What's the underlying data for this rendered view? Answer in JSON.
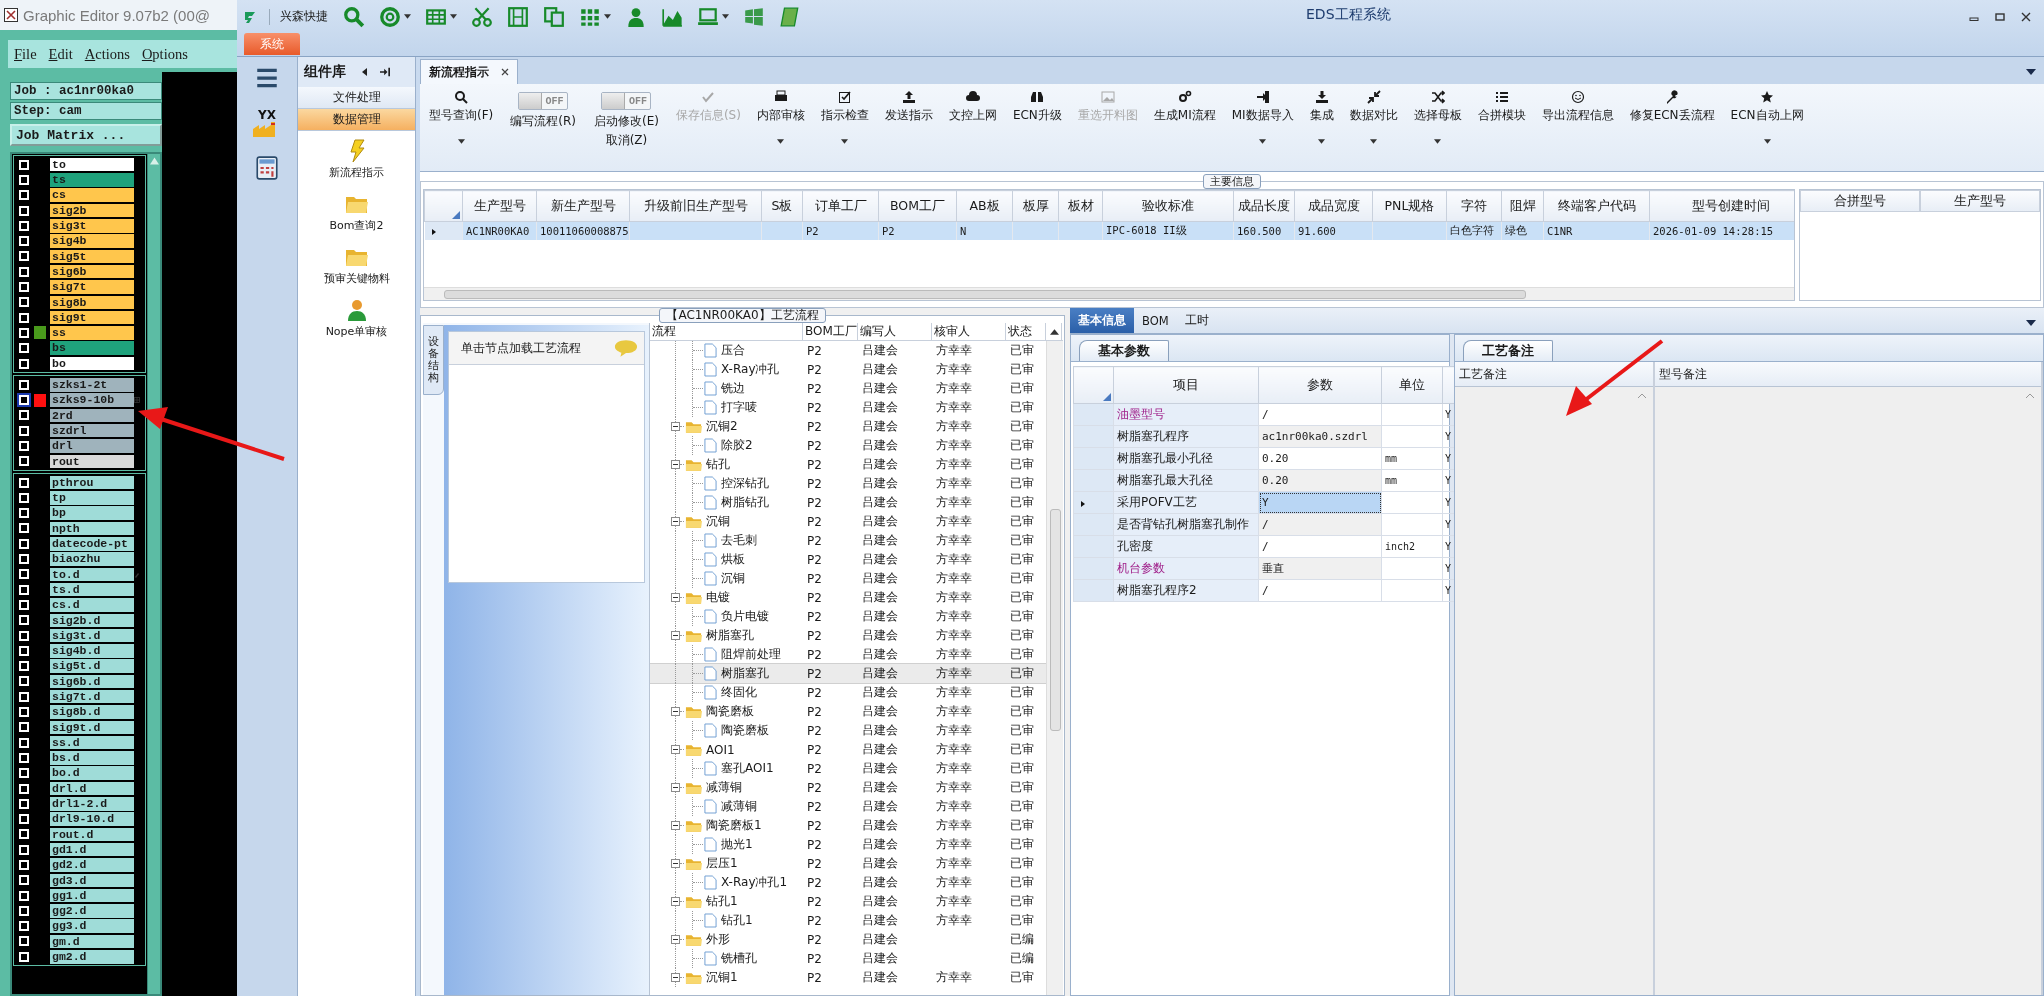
{
  "graphic_editor": {
    "title": "Graphic Editor 9.07b2 (00@",
    "menu": [
      "File",
      "Edit",
      "Actions",
      "Options"
    ],
    "job": "Job : ac1nr00ka0",
    "step": "Step: cam",
    "matrix_button": "Job Matrix ...",
    "layer_groups": [
      [
        {
          "name": "to",
          "color": "#ffffff",
          "checked": false,
          "selected": false
        },
        {
          "name": "ts",
          "color": "#1fa27c",
          "checked": false,
          "selected": false
        },
        {
          "name": "cs",
          "color": "#ffc64c",
          "checked": false,
          "selected": false
        },
        {
          "name": "sig2b",
          "color": "#ffc64c",
          "checked": false,
          "selected": false
        },
        {
          "name": "sig3t",
          "color": "#ffc64c",
          "checked": false,
          "selected": false
        },
        {
          "name": "sig4b",
          "color": "#ffc64c",
          "checked": false,
          "selected": false
        },
        {
          "name": "sig5t",
          "color": "#ffc64c",
          "checked": false,
          "selected": false
        },
        {
          "name": "sig6b",
          "color": "#ffc64c",
          "checked": false,
          "selected": false
        },
        {
          "name": "sig7t",
          "color": "#ffc64c",
          "checked": false,
          "selected": false
        },
        {
          "name": "sig8b",
          "color": "#ffc64c",
          "checked": false,
          "selected": false
        },
        {
          "name": "sig9t",
          "color": "#ffc64c",
          "checked": false,
          "selected": false
        },
        {
          "name": "ss",
          "color": "#ffc64c",
          "checked": false,
          "selected": false,
          "marker": {
            "color": "#4a9a1c"
          }
        },
        {
          "name": "bs",
          "color": "#1fa27c",
          "checked": false,
          "selected": false
        },
        {
          "name": "bo",
          "color": "#ffffff",
          "checked": false,
          "selected": false
        }
      ],
      [
        {
          "name": "szks1-2t",
          "color": "#9fb3bc",
          "checked": false,
          "selected": false
        },
        {
          "name": "szks9-10b",
          "color": "#9fb3bc",
          "checked": false,
          "selected": true,
          "marker": {
            "color": "#ff1010"
          },
          "badge": {
            "kind": "grid"
          }
        },
        {
          "name": "2rd",
          "color": "#9fb3bc",
          "checked": false,
          "selected": false
        },
        {
          "name": "szdrl",
          "color": "#9fb3bc",
          "checked": false,
          "selected": false
        },
        {
          "name": "drl",
          "color": "#9fb3bc",
          "checked": false,
          "selected": false
        },
        {
          "name": "rout",
          "color": "#d9d9d9",
          "checked": false,
          "selected": false
        }
      ],
      [
        {
          "name": "pthrou",
          "color": "#9fdcd8",
          "checked": false,
          "selected": false
        },
        {
          "name": "tp",
          "color": "#9fdcd8",
          "checked": false,
          "selected": false
        },
        {
          "name": "bp",
          "color": "#9fdcd8",
          "checked": false,
          "selected": false
        },
        {
          "name": "npth",
          "color": "#9fdcd8",
          "checked": false,
          "selected": false
        },
        {
          "name": "datecode-pt",
          "color": "#9fdcd8",
          "checked": false,
          "selected": false
        },
        {
          "name": "biaozhu",
          "color": "#9fdcd8",
          "checked": false,
          "selected": false
        },
        {
          "name": "to.d",
          "color": "#9fdcd8",
          "checked": false,
          "selected": false,
          "badge": {
            "kind": "pen"
          }
        },
        {
          "name": "ts.d",
          "color": "#9fdcd8",
          "checked": false,
          "selected": false
        },
        {
          "name": "cs.d",
          "color": "#9fdcd8",
          "checked": false,
          "selected": false
        },
        {
          "name": "sig2b.d",
          "color": "#9fdcd8",
          "checked": false,
          "selected": false
        },
        {
          "name": "sig3t.d",
          "color": "#9fdcd8",
          "checked": false,
          "selected": false
        },
        {
          "name": "sig4b.d",
          "color": "#9fdcd8",
          "checked": false,
          "selected": false
        },
        {
          "name": "sig5t.d",
          "color": "#9fdcd8",
          "checked": false,
          "selected": false
        },
        {
          "name": "sig6b.d",
          "color": "#9fdcd8",
          "checked": false,
          "selected": false
        },
        {
          "name": "sig7t.d",
          "color": "#9fdcd8",
          "checked": false,
          "selected": false
        },
        {
          "name": "sig8b.d",
          "color": "#9fdcd8",
          "checked": false,
          "selected": false
        },
        {
          "name": "sig9t.d",
          "color": "#9fdcd8",
          "checked": false,
          "selected": false
        },
        {
          "name": "ss.d",
          "color": "#9fdcd8",
          "checked": false,
          "selected": false
        },
        {
          "name": "bs.d",
          "color": "#9fdcd8",
          "checked": false,
          "selected": false
        },
        {
          "name": "bo.d",
          "color": "#9fdcd8",
          "checked": false,
          "selected": false
        },
        {
          "name": "drl.d",
          "color": "#9fdcd8",
          "checked": false,
          "selected": false
        },
        {
          "name": "drl1-2.d",
          "color": "#9fdcd8",
          "checked": false,
          "selected": false
        },
        {
          "name": "drl9-10.d",
          "color": "#9fdcd8",
          "checked": false,
          "selected": false
        },
        {
          "name": "rout.d",
          "color": "#9fdcd8",
          "checked": false,
          "selected": false
        },
        {
          "name": "gd1.d",
          "color": "#9fdcd8",
          "checked": false,
          "selected": false
        },
        {
          "name": "gd2.d",
          "color": "#9fdcd8",
          "checked": false,
          "selected": false
        },
        {
          "name": "gd3.d",
          "color": "#9fdcd8",
          "checked": false,
          "selected": false
        },
        {
          "name": "gg1.d",
          "color": "#9fdcd8",
          "checked": false,
          "selected": false
        },
        {
          "name": "gg2.d",
          "color": "#9fdcd8",
          "checked": false,
          "selected": false
        },
        {
          "name": "gg3.d",
          "color": "#9fdcd8",
          "checked": false,
          "selected": false
        },
        {
          "name": "gm.d",
          "color": "#9fdcd8",
          "checked": false,
          "selected": false
        },
        {
          "name": "gm2.d",
          "color": "#9fdcd8",
          "checked": false,
          "selected": false
        }
      ]
    ]
  },
  "eds": {
    "brand": "兴森快捷",
    "title": "EDS工程系统",
    "ribbon_tab": "系统",
    "quick_toolbar": [
      {
        "dropdown": false
      },
      {
        "dropdown": true
      },
      {
        "dropdown": true
      },
      {
        "dropdown": false
      },
      {
        "dropdown": false
      },
      {
        "dropdown": false
      },
      {
        "dropdown": true
      },
      {
        "dropdown": false
      },
      {
        "dropdown": false
      },
      {
        "dropdown": true
      },
      {
        "dropdown": false
      },
      {
        "dropdown": false
      }
    ],
    "nav": [
      {
        "kind": "menu"
      },
      {
        "kind": "factory",
        "text": "YX"
      },
      {
        "kind": "calculator"
      }
    ],
    "library": {
      "title": "组件库",
      "sections": [
        {
          "label": "文件处理",
          "selected": false
        },
        {
          "label": "数据管理",
          "selected": true
        }
      ],
      "items": [
        {
          "kind": "lightning",
          "label": "新流程指示"
        },
        {
          "kind": "folder",
          "label": "Bom查询2"
        },
        {
          "kind": "folder",
          "label": "预审关键物料"
        },
        {
          "kind": "user",
          "label": "Nope单审核"
        }
      ]
    },
    "doc_tabs": [
      {
        "label": "新流程指示",
        "selected": true
      }
    ],
    "toolbar": [
      {
        "kind": "button",
        "label": "型号查询(F)",
        "disabled": false,
        "dropdown": true
      },
      {
        "kind": "toggle",
        "label": "编写流程(R)",
        "toggle_text": "OFF",
        "on": false
      },
      {
        "kind": "toggle",
        "label": "启动修改(E)",
        "sublabel": "取消(Z)",
        "toggle_text": "OFF",
        "on": false
      },
      {
        "kind": "button",
        "label": "保存信息(S)",
        "disabled": true,
        "dropdown": false
      },
      {
        "kind": "button",
        "label": "内部审核",
        "disabled": false,
        "dropdown": true
      },
      {
        "kind": "button",
        "label": "指示检查",
        "disabled": false,
        "dropdown": true
      },
      {
        "kind": "button",
        "label": "发送指示",
        "disabled": false,
        "dropdown": false
      },
      {
        "kind": "button",
        "label": "文控上网",
        "disabled": false,
        "dropdown": false
      },
      {
        "kind": "button",
        "label": "ECN升级",
        "disabled": false,
        "dropdown": false
      },
      {
        "kind": "button",
        "label": "重选开料图",
        "disabled": true,
        "dropdown": false
      },
      {
        "kind": "button",
        "label": "生成MI流程",
        "disabled": false,
        "dropdown": false
      },
      {
        "kind": "button",
        "label": "MI数据导入",
        "disabled": false,
        "dropdown": true
      },
      {
        "kind": "button",
        "label": "集成",
        "disabled": false,
        "dropdown": true
      },
      {
        "kind": "button",
        "label": "数据对比",
        "disabled": false,
        "dropdown": true
      },
      {
        "kind": "button",
        "label": "选择母板",
        "disabled": false,
        "dropdown": true
      },
      {
        "kind": "button",
        "label": "合拼模块",
        "disabled": false,
        "dropdown": false
      },
      {
        "kind": "button",
        "label": "导出流程信息",
        "disabled": false,
        "dropdown": false
      },
      {
        "kind": "button",
        "label": "修复ECN丢流程",
        "disabled": false,
        "dropdown": false
      },
      {
        "kind": "button",
        "label": "ECN自动上网",
        "disabled": false,
        "dropdown": true
      }
    ],
    "main_info": {
      "title": "主要信息",
      "columns": [
        "生产型号",
        "新生产型号",
        "升级前旧生产型号",
        "S板",
        "订单工厂",
        "BOM工厂",
        "AB板",
        "板厚",
        "板材",
        "验收标准",
        "成品长度",
        "成品宽度",
        "PNL规格",
        "字符",
        "阻焊",
        "终端客户代码",
        "型号创建时间"
      ],
      "rows": [
        {
          "selected": true,
          "cells": [
            "AC1NR00KA0",
            "10011060008875",
            null,
            null,
            "P2",
            "P2",
            "N",
            null,
            null,
            "IPC-6018 II级",
            "160.500",
            "91.600",
            null,
            "白色字符",
            "绿色",
            "C1NR",
            "2026-01-09 14:28:15"
          ]
        }
      ],
      "side_columns": [
        "合拼型号",
        "生产型号"
      ]
    },
    "process": {
      "title": "【AC1NR00KA0】工艺流程",
      "side_tab": "设备结构",
      "hint": "单击节点加载工艺流程",
      "columns": [
        "流程",
        "BOM工厂",
        "编写人",
        "核审人",
        "状态"
      ],
      "tree": [
        {
          "children": [
            {
              "label": "压合",
              "factory": "P2",
              "writer": "吕建会",
              "reviewer": "方幸幸",
              "status": "已审",
              "selected": false
            },
            {
              "label": "X-Ray冲孔",
              "factory": "P2",
              "writer": "吕建会",
              "reviewer": "方幸幸",
              "status": "已审",
              "selected": false
            },
            {
              "label": "铣边",
              "factory": "P2",
              "writer": "吕建会",
              "reviewer": "方幸幸",
              "status": "已审",
              "selected": false
            },
            {
              "label": "打字唛",
              "factory": "P2",
              "writer": "吕建会",
              "reviewer": "方幸幸",
              "status": "已审",
              "selected": false
            }
          ]
        },
        {
          "label": "沉铜2",
          "factory": "P2",
          "writer": "吕建会",
          "reviewer": "方幸幸",
          "status": "已审",
          "selected": false,
          "expanded": true,
          "children": [
            {
              "label": "除胶2",
              "factory": "P2",
              "writer": "吕建会",
              "reviewer": "方幸幸",
              "status": "已审",
              "selected": false
            }
          ]
        },
        {
          "label": "钻孔",
          "factory": "P2",
          "writer": "吕建会",
          "reviewer": "方幸幸",
          "status": "已审",
          "selected": false,
          "expanded": true,
          "children": [
            {
              "label": "控深钻孔",
              "factory": "P2",
              "writer": "吕建会",
              "reviewer": "方幸幸",
              "status": "已审",
              "selected": false
            },
            {
              "label": "树脂钻孔",
              "factory": "P2",
              "writer": "吕建会",
              "reviewer": "方幸幸",
              "status": "已审",
              "selected": false
            }
          ]
        },
        {
          "label": "沉铜",
          "factory": "P2",
          "writer": "吕建会",
          "reviewer": "方幸幸",
          "status": "已审",
          "selected": false,
          "expanded": true,
          "children": [
            {
              "label": "去毛刺",
              "factory": "P2",
              "writer": "吕建会",
              "reviewer": "方幸幸",
              "status": "已审",
              "selected": false
            },
            {
              "label": "烘板",
              "factory": "P2",
              "writer": "吕建会",
              "reviewer": "方幸幸",
              "status": "已审",
              "selected": false
            },
            {
              "label": "沉铜",
              "factory": "P2",
              "writer": "吕建会",
              "reviewer": "方幸幸",
              "status": "已审",
              "selected": false
            }
          ]
        },
        {
          "label": "电镀",
          "factory": "P2",
          "writer": "吕建会",
          "reviewer": "方幸幸",
          "status": "已审",
          "selected": false,
          "expanded": true,
          "children": [
            {
              "label": "负片电镀",
              "factory": "P2",
              "writer": "吕建会",
              "reviewer": "方幸幸",
              "status": "已审",
              "selected": false
            }
          ]
        },
        {
          "label": "树脂塞孔",
          "factory": "P2",
          "writer": "吕建会",
          "reviewer": "方幸幸",
          "status": "已审",
          "selected": false,
          "expanded": true,
          "children": [
            {
              "label": "阻焊前处理",
              "factory": "P2",
              "writer": "吕建会",
              "reviewer": "方幸幸",
              "status": "已审",
              "selected": false
            },
            {
              "label": "树脂塞孔",
              "factory": "P2",
              "writer": "吕建会",
              "reviewer": "方幸幸",
              "status": "已审",
              "selected": true
            },
            {
              "label": "终固化",
              "factory": "P2",
              "writer": "吕建会",
              "reviewer": "方幸幸",
              "status": "已审",
              "selected": false
            }
          ]
        },
        {
          "label": "陶瓷磨板",
          "factory": "P2",
          "writer": "吕建会",
          "reviewer": "方幸幸",
          "status": "已审",
          "selected": false,
          "expanded": true,
          "children": [
            {
              "label": "陶瓷磨板",
              "factory": "P2",
              "writer": "吕建会",
              "reviewer": "方幸幸",
              "status": "已审",
              "selected": false
            }
          ]
        },
        {
          "label": "AOI1",
          "factory": "P2",
          "writer": "吕建会",
          "reviewer": "方幸幸",
          "status": "已审",
          "selected": false,
          "expanded": true,
          "children": [
            {
              "label": "塞孔AOI1",
              "factory": "P2",
              "writer": "吕建会",
              "reviewer": "方幸幸",
              "status": "已审",
              "selected": false
            }
          ]
        },
        {
          "label": "减薄铜",
          "factory": "P2",
          "writer": "吕建会",
          "reviewer": "方幸幸",
          "status": "已审",
          "selected": false,
          "expanded": true,
          "children": [
            {
              "label": "减薄铜",
              "factory": "P2",
              "writer": "吕建会",
              "reviewer": "方幸幸",
              "status": "已审",
              "selected": false
            }
          ]
        },
        {
          "label": "陶瓷磨板1",
          "factory": "P2",
          "writer": "吕建会",
          "reviewer": "方幸幸",
          "status": "已审",
          "selected": false,
          "expanded": true,
          "children": [
            {
              "label": "抛光1",
              "factory": "P2",
              "writer": "吕建会",
              "reviewer": "方幸幸",
              "status": "已审",
              "selected": false
            }
          ]
        },
        {
          "label": "层压1",
          "factory": "P2",
          "writer": "吕建会",
          "reviewer": "方幸幸",
          "status": "已审",
          "selected": false,
          "expanded": true,
          "children": [
            {
              "label": "X-Ray冲孔1",
              "factory": "P2",
              "writer": "吕建会",
              "reviewer": "方幸幸",
              "status": "已审",
              "selected": false
            }
          ]
        },
        {
          "label": "钻孔1",
          "factory": "P2",
          "writer": "吕建会",
          "reviewer": "方幸幸",
          "status": "已审",
          "selected": false,
          "expanded": true,
          "children": [
            {
              "label": "钻孔1",
              "factory": "P2",
              "writer": "吕建会",
              "reviewer": "方幸幸",
              "status": "已审",
              "selected": false
            }
          ]
        },
        {
          "label": "外形",
          "factory": "P2",
          "writer": "吕建会",
          "status": "已编",
          "selected": false,
          "expanded": true,
          "children": [
            {
              "label": "铣槽孔",
              "factory": "P2",
              "writer": "吕建会",
              "status": "已编",
              "selected": false
            }
          ]
        },
        {
          "label": "沉铜1",
          "factory": "P2",
          "writer": "吕建会",
          "reviewer": "方幸幸",
          "status": "已审",
          "selected": false,
          "expanded": true
        }
      ]
    },
    "detail": {
      "tabs": [
        {
          "label": "基本信息",
          "selected": true
        },
        {
          "label": "BOM",
          "selected": false
        },
        {
          "label": "工时",
          "selected": false
        }
      ],
      "params_tab": "基本参数",
      "params_columns": [
        "项目",
        "参数",
        "单位"
      ],
      "params": [
        {
          "item": "油墨型号",
          "value": "/",
          "flag": "Y",
          "highlighted": true,
          "selected": false
        },
        {
          "item": "树脂塞孔程序",
          "value": "ac1nr00ka0.szdrl",
          "flag": "Y",
          "highlighted": false,
          "selected": false
        },
        {
          "item": "树脂塞孔最小孔径",
          "value": "0.20",
          "unit": "mm",
          "flag": "Y",
          "highlighted": false,
          "selected": false
        },
        {
          "item": "树脂塞孔最大孔径",
          "value": "0.20",
          "unit": "mm",
          "flag": "Y",
          "highlighted": false,
          "selected": false
        },
        {
          "item": "采用POFV工艺",
          "value": "Y",
          "flag": "Y",
          "highlighted": false,
          "selected": true
        },
        {
          "item": "是否背钻孔树脂塞孔制作",
          "value": "/",
          "flag": "Y",
          "highlighted": false,
          "selected": false
        },
        {
          "item": "孔密度",
          "value": "/",
          "unit": "inch2",
          "flag": "Y",
          "highlighted": false,
          "selected": false
        },
        {
          "item": "机台参数",
          "value": "垂直",
          "flag": "Y",
          "highlighted": true,
          "selected": false
        },
        {
          "item": "树脂塞孔程序2",
          "value": "/",
          "flag": "Y",
          "highlighted": false,
          "selected": false
        }
      ],
      "notes_tab": "工艺备注",
      "notes_columns": [
        "工艺备注",
        "型号备注"
      ]
    }
  }
}
